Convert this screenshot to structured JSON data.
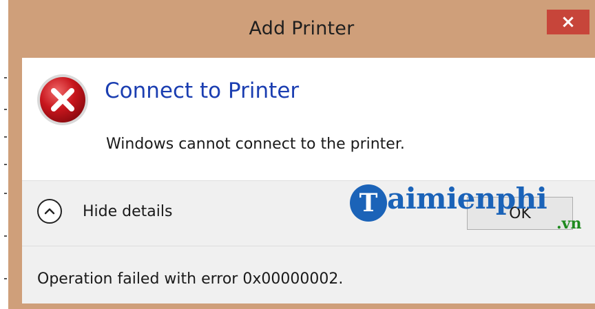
{
  "window": {
    "title": "Add Printer",
    "close_glyph": "×"
  },
  "dialog": {
    "heading": "Connect to Printer",
    "message": "Windows cannot connect to the printer.",
    "icon": "error-x-icon"
  },
  "footer": {
    "details_toggle_label": "Hide details",
    "ok_label": "OK",
    "details_text": "Operation failed with error 0x00000002."
  },
  "watermark": {
    "logo_letter": "T",
    "brand": "aimienphi",
    "tld": ".vn"
  },
  "colors": {
    "titlebar": "#cf9f7a",
    "close": "#c7453a",
    "heading": "#1b3eb1",
    "error_icon": "#c8161d"
  }
}
